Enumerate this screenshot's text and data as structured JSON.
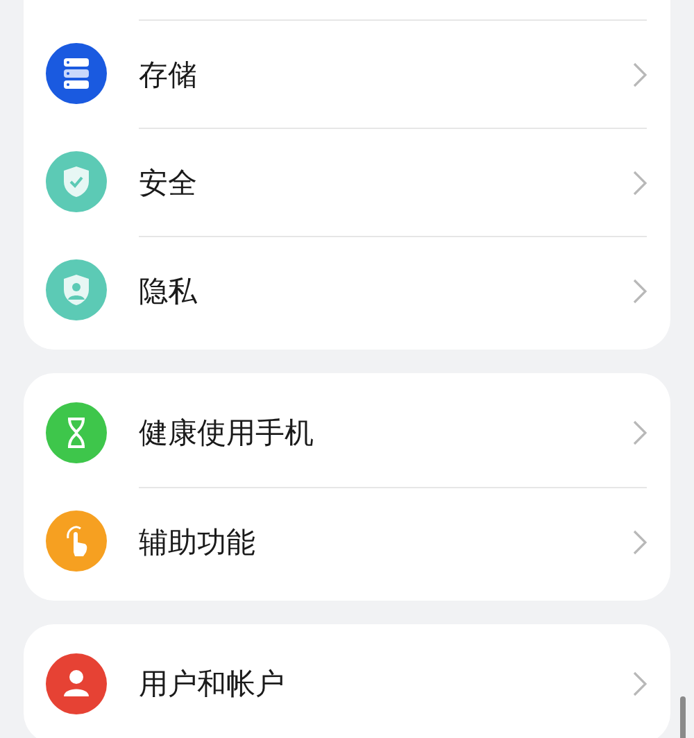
{
  "groups": [
    {
      "items": [
        {
          "label": "存储",
          "kind": "storage",
          "color": "#1a5ae0"
        },
        {
          "label": "安全",
          "kind": "shield",
          "color": "#5ccab5"
        },
        {
          "label": "隐私",
          "kind": "privacy",
          "color": "#5ccab5"
        }
      ]
    },
    {
      "items": [
        {
          "label": "健康使用手机",
          "kind": "hourglass",
          "color": "#3ec64b"
        },
        {
          "label": "辅助功能",
          "kind": "hand",
          "color": "#f6a021"
        }
      ]
    },
    {
      "items": [
        {
          "label": "用户和帐户",
          "kind": "user",
          "color": "#e64234"
        }
      ]
    }
  ]
}
